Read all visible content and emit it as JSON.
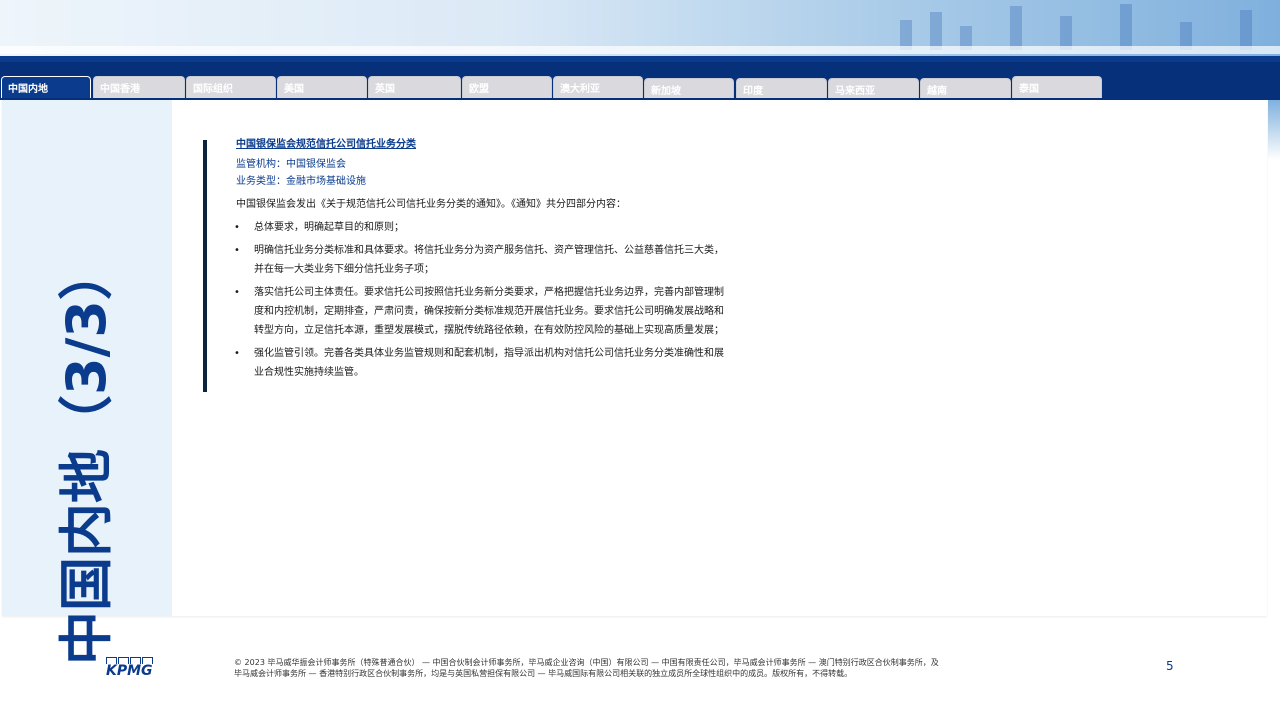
{
  "tabs": [
    {
      "label": "中国内地",
      "active": true
    },
    {
      "label": "中国香港"
    },
    {
      "label": "国际组织"
    },
    {
      "label": "美国"
    },
    {
      "label": "英国"
    },
    {
      "label": "欧盟"
    },
    {
      "label": "澳大利亚"
    },
    {
      "label": "新加坡"
    },
    {
      "label": "印度"
    },
    {
      "label": "马来西亚"
    },
    {
      "label": "越南"
    },
    {
      "label": "泰国"
    }
  ],
  "side_title": "中国内地（3/3）",
  "article": {
    "title": "中国银保监会规范信托公司信托业务分类",
    "regulator": "监管机构：中国银保监会",
    "business_type": "业务类型：金融市场基础设施",
    "intro": "中国银保监会发出《关于规范信托公司信托业务分类的通知》。《通知》共分四部分内容：",
    "bullets": [
      "总体要求，明确起草目的和原则；",
      "明确信托业务分类标准和具体要求。将信托业务分为资产服务信托、资产管理信托、公益慈善信托三大类，并在每一大类业务下细分信托业务子项；",
      "落实信托公司主体责任。要求信托公司按照信托业务新分类要求，严格把握信托业务边界，完善内部管理制度和内控机制，定期排查，严肃问责，确保按新分类标准规范开展信托业务。要求信托公司明确发展战略和转型方向，立足信托本源，重塑发展模式，摆脱传统路径依赖，在有效防控风险的基础上实现高质量发展；",
      "强化监管引领。完善各类具体业务监管规则和配套机制，指导派出机构对信托公司信托业务分类准确性和展业合规性实施持续监管。"
    ],
    "bullet_glyph": "•"
  },
  "footer": {
    "logo": "KPMG",
    "line1": "© 2023 毕马威华振会计师事务所（特殊普通合伙） — 中国合伙制会计师事务所，毕马威企业咨询（中国）有限公司 — 中国有限责任公司，毕马威会计师事务所 — 澳门特别行政区合伙制事务所，及",
    "line2": "毕马威会计师事务所 — 香港特别行政区合伙制事务所，均是与英国私营担保有限公司 — 毕马威国际有限公司相关联的独立成员所全球性组织中的成员。版权所有，不得转载。",
    "page_number": "5"
  },
  "colors": {
    "brand_blue": "#0a3b8c",
    "nav_dark": "#07307a",
    "side_panel": "#e8f2fa",
    "tab_inactive": "#d9d9de"
  }
}
